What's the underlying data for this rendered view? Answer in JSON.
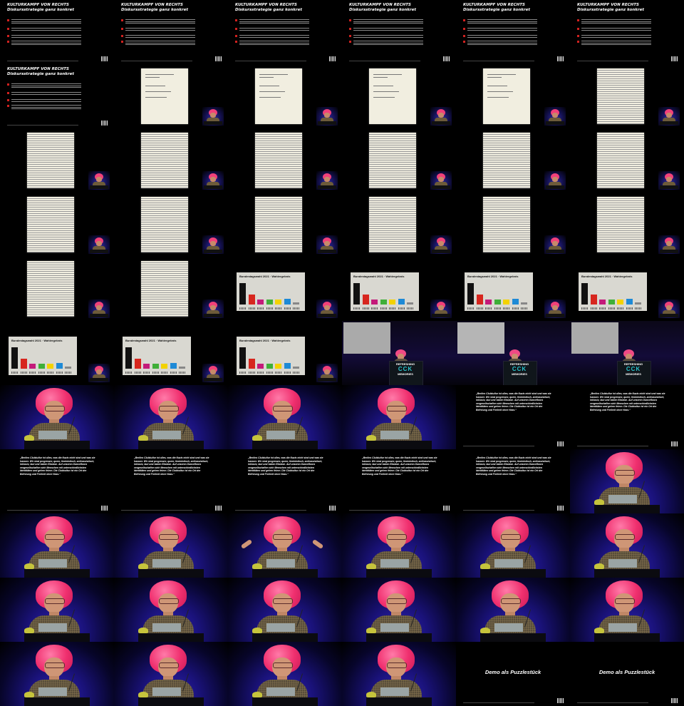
{
  "slide": {
    "title_line1": "KULTURKAMPF VON RECHTS",
    "title_line2": "Diskursstrategie ganz konkret",
    "bullets": 4,
    "quote": "„Berlins Clubkultur ist alles, was die Nazis nicht sind und was sie hassen: Wir sind progressiv, queer, feministisch, antirassistisch, inklusiv, laut und haben Ekstase. Auf unseren Dancefloors vergesellschaften sich Menschen mit unterschiedlichsten Identitäten und gehen feiern. Die Clubkultur ist ein Ort der Befreiung und Freiheit ohne Hass.“",
    "demo": "Demo als Puzzlestück"
  },
  "chart": {
    "title": "Bundestagswahl 2021 · Wahlergebnis",
    "colors": [
      "#111111",
      "#d7261e",
      "#c41a7a",
      "#3faf38",
      "#f3d200",
      "#1e8ad6",
      "#888888"
    ],
    "levels": [
      1.0,
      0.46,
      0.22,
      0.22,
      0.24,
      0.28,
      0.1
    ]
  },
  "stage": {
    "logo_top": "REFRESHING",
    "logo_big": "CCK",
    "logo_bottom": "MEMORIES"
  },
  "cells": [
    "kk",
    "kk",
    "kk",
    "kk",
    "kk",
    "kk",
    "kk",
    "doc",
    "doc",
    "doc",
    "doc",
    "docl",
    "docl",
    "docl",
    "docl",
    "docl",
    "docl",
    "docl",
    "docl",
    "docl",
    "docl",
    "docl",
    "docl",
    "docl",
    "docl",
    "docl",
    "chart",
    "chart",
    "chart",
    "chart",
    "chart",
    "chart",
    "chart",
    "stage",
    "stage2",
    "stage",
    "cu",
    "cu",
    "cu",
    "cu",
    "quote",
    "quote",
    "quote",
    "quote",
    "quote",
    "quote",
    "quote",
    "cu",
    "cu",
    "cu",
    "cuarms",
    "cu",
    "cu",
    "cu",
    "cu",
    "cu",
    "cu",
    "cu",
    "cu",
    "cu",
    "cu",
    "cu",
    "cu",
    "cu",
    "demo",
    "demo"
  ]
}
